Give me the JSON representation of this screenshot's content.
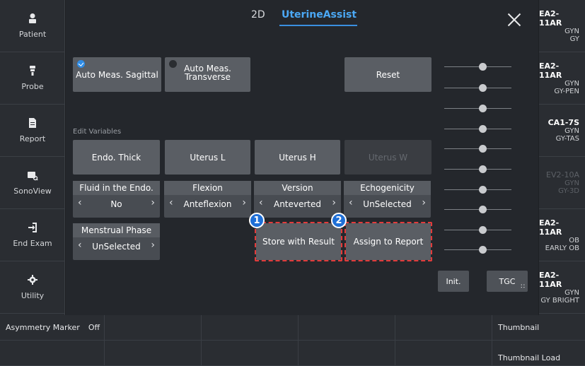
{
  "sidebar": {
    "items": [
      {
        "label": "Patient",
        "icon": "person-icon"
      },
      {
        "label": "Probe",
        "icon": "probe-icon"
      },
      {
        "label": "Report",
        "icon": "document-icon"
      },
      {
        "label": "SonoView",
        "icon": "sonoview-icon"
      },
      {
        "label": "End Exam",
        "icon": "exit-icon"
      },
      {
        "label": "Utility",
        "icon": "gear-icon"
      }
    ]
  },
  "header": {
    "mode_2d": "2D",
    "tab_active": "UterineAssist"
  },
  "buttons": {
    "auto_meas_sagittal": "Auto Meas. Sagittal",
    "auto_meas_transverse_l1": "Auto Meas.",
    "auto_meas_transverse_l2": "Transverse",
    "reset": "Reset",
    "store_with_result": "Store with Result",
    "assign_to_report": "Assign to Report",
    "init": "Init.",
    "tgc": "TGC"
  },
  "edit_variables": {
    "label": "Edit Variables",
    "items": [
      "Endo. Thick",
      "Uterus L",
      "Uterus H",
      "Uterus W"
    ]
  },
  "selectors": [
    {
      "title": "Fluid in the Endo.",
      "value": "No"
    },
    {
      "title": "Flexion",
      "value": "Anteflexion"
    },
    {
      "title": "Version",
      "value": "Anteverted"
    },
    {
      "title": "Echogenicity",
      "value": "UnSelected"
    },
    {
      "title": "Menstrual Phase",
      "value": "UnSelected"
    }
  ],
  "badges": [
    "1",
    "2"
  ],
  "probes": [
    {
      "name": "EA2-11AR",
      "app": "GYN",
      "preset": "GY"
    },
    {
      "name": "EA2-11AR",
      "app": "GYN",
      "preset": "GY-PEN"
    },
    {
      "name": "CA1-7S",
      "app": "GYN",
      "preset": "GY-TAS"
    },
    {
      "name": "EV2-10A",
      "app": "GYN",
      "preset": "GY-3D"
    },
    {
      "name": "EA2-11AR",
      "app": "OB",
      "preset": "EARLY OB"
    },
    {
      "name": "EA2-11AR",
      "app": "GYN",
      "preset": "GY BRIGHT"
    }
  ],
  "bottom": {
    "asymmetry_marker": "Asymmetry Marker",
    "asymmetry_value": "Off",
    "thumbnail": "Thumbnail",
    "thumbnail_load": "Thumbnail Load"
  },
  "colors": {
    "accent": "#3a8fe0",
    "highlight": "#e23b3b",
    "badge": "#1f6fd6"
  }
}
